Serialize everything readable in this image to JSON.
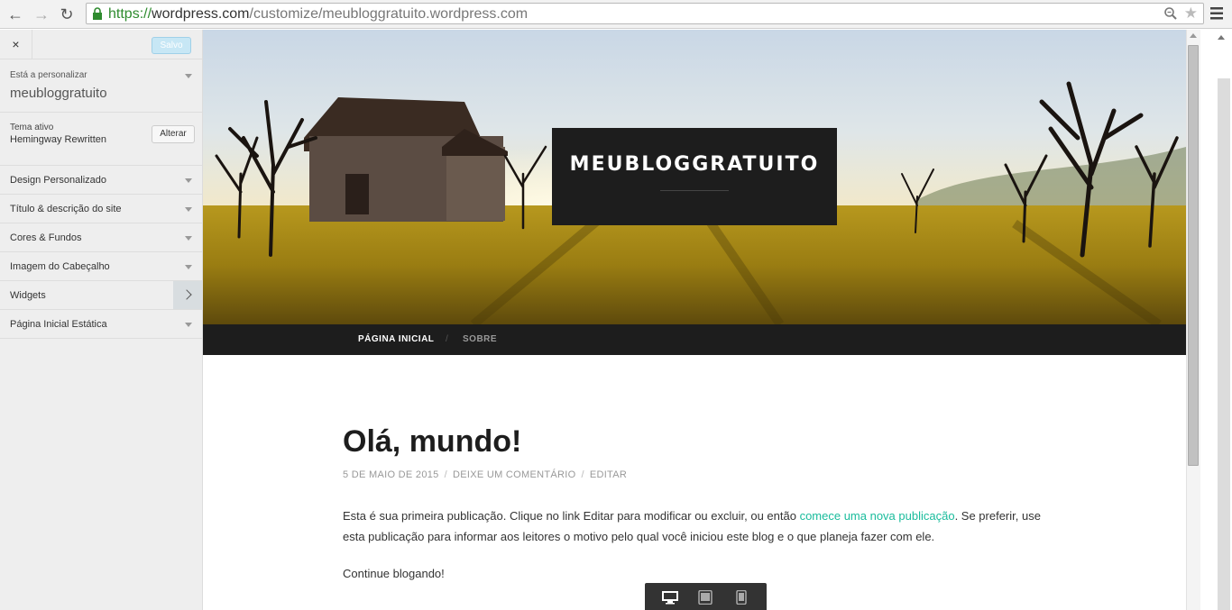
{
  "browser": {
    "url_scheme": "https://",
    "url_domain": "wordpress.com",
    "url_path": "/customize/meubloggratuito.wordpress.com",
    "back_icon": "arrow-left-icon",
    "forward_icon": "arrow-right-icon",
    "reload_icon": "reload-icon"
  },
  "customizer": {
    "close_label": "×",
    "saved_label": "Salvo",
    "customizing_label": "Está a personalizar",
    "site_name": "meubloggratuito",
    "active_theme_label": "Tema ativo",
    "theme_name": "Hemingway Rewritten",
    "change_label": "Alterar",
    "sections": [
      {
        "label": "Design Personalizado"
      },
      {
        "label": "Título & descrição do site"
      },
      {
        "label": "Cores & Fundos"
      },
      {
        "label": "Imagem do Cabeçalho"
      },
      {
        "label": "Widgets"
      },
      {
        "label": "Página Inicial Estática"
      }
    ]
  },
  "site": {
    "title": "MEUBLOGGRATUITO",
    "nav": {
      "home": "PÁGINA INICIAL",
      "separator": "/",
      "about": "SOBRE"
    },
    "post": {
      "title": "Olá, mundo!",
      "date": "5 DE MAIO DE 2015",
      "comment": "DEIXE UM COMENTÁRIO",
      "edit": "EDITAR",
      "meta_sep": "/",
      "body_before": "Esta é sua primeira publicação. Clique no link Editar para modificar ou excluir, ou então ",
      "body_link": "comece uma nova publicação",
      "body_after": ". Se preferir, use esta publicação para informar aos leitores o motivo pelo qual você iniciou este blog e o que planeja fazer com ele.",
      "body2": "Continue blogando!"
    }
  },
  "colors": {
    "accent_link": "#1abc9c",
    "header_dark": "#1d1d1d"
  }
}
